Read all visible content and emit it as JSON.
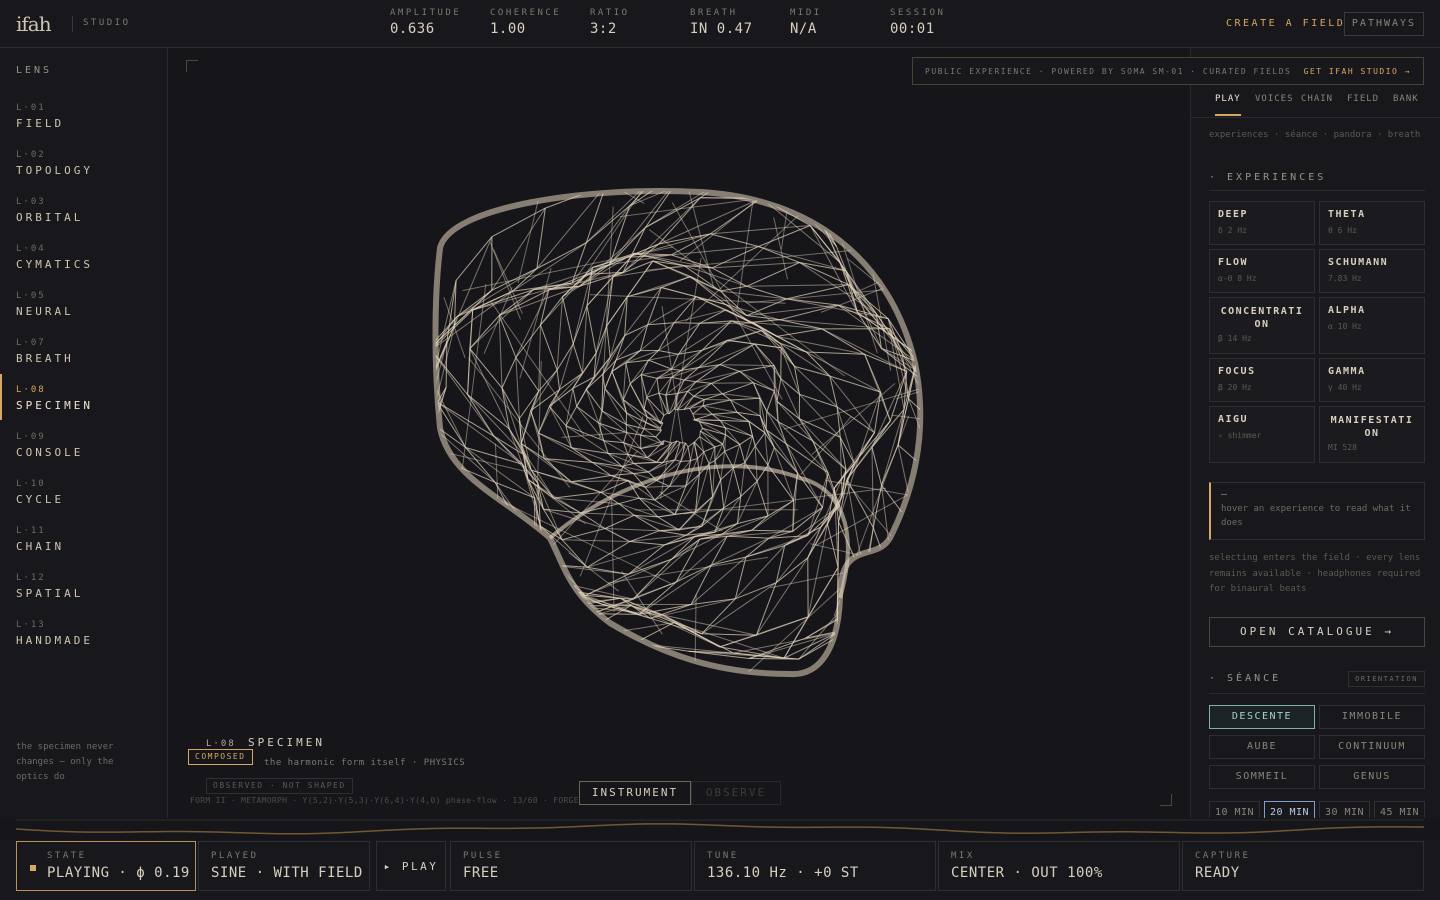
{
  "header": {
    "logo": "ifah",
    "studio": "STUDIO",
    "metrics": [
      {
        "label": "AMPLITUDE",
        "value": "0.636"
      },
      {
        "label": "COHERENCE",
        "value": "1.00"
      },
      {
        "label": "RATIO",
        "value": "3:2"
      },
      {
        "label": "BREATH",
        "value": "IN 0.47"
      },
      {
        "label": "MIDI",
        "value": "N/A"
      },
      {
        "label": "SESSION",
        "value": "00:01"
      }
    ],
    "create_label": "CREATE A FIELD",
    "pathways_label": "PATHWAYS"
  },
  "sidebar": {
    "title": "LENS",
    "items": [
      {
        "code": "L·01",
        "name": "FIELD"
      },
      {
        "code": "L·02",
        "name": "TOPOLOGY"
      },
      {
        "code": "L·03",
        "name": "ORBITAL"
      },
      {
        "code": "L·04",
        "name": "CYMATICS"
      },
      {
        "code": "L·05",
        "name": "NEURAL"
      },
      {
        "code": "L·07",
        "name": "BREATH"
      },
      {
        "code": "L·08",
        "name": "SPECIMEN"
      },
      {
        "code": "L·09",
        "name": "CONSOLE"
      },
      {
        "code": "L·10",
        "name": "CYCLE"
      },
      {
        "code": "L·11",
        "name": "CHAIN"
      },
      {
        "code": "L·12",
        "name": "SPATIAL"
      },
      {
        "code": "L·13",
        "name": "HANDMADE"
      }
    ],
    "active_index": 6,
    "note": "the specimen never changes — only the optics do"
  },
  "canvas": {
    "caption_code": "L·08",
    "caption_name": "SPECIMEN",
    "composed_badge": "COMPOSED",
    "description": "the harmonic form itself · PHYSICS",
    "observed_badge": "OBSERVED · NOT SHAPED",
    "formula": "FORM II · METAMORPH · Y(5,2)·Y(5,3)·Y(6,4)·Y(4,0) phase-flow · 13/60 · FORGED IN BLENDER · press E to alternate",
    "mode_instrument": "INSTRUMENT",
    "mode_observe": "OBSERVE"
  },
  "banner": {
    "text": "PUBLIC EXPERIENCE · POWERED BY SOMA SM-01 · CURATED FIELDS",
    "cta": "GET IFAH STUDIO →"
  },
  "panel": {
    "tabs": [
      "PLAY",
      "VOICES",
      "CHAIN",
      "FIELD",
      "BANK"
    ],
    "active_tab": "PLAY",
    "crumbs": "experiences · séance · pandora · breath",
    "experiences_title": "· EXPERIENCES",
    "experiences": [
      {
        "name": "DEEP",
        "freq": "δ 2 Hz"
      },
      {
        "name": "THETA",
        "freq": "θ 6 Hz"
      },
      {
        "name": "FLOW",
        "freq": "α-θ 8 Hz"
      },
      {
        "name": "SCHUMANN",
        "freq": "7.83 Hz"
      },
      {
        "name": "CONCENTRATION",
        "freq": "β 14 Hz"
      },
      {
        "name": "ALPHA",
        "freq": "α 10 Hz"
      },
      {
        "name": "FOCUS",
        "freq": "β 20 Hz"
      },
      {
        "name": "GAMMA",
        "freq": "γ 40 Hz"
      },
      {
        "name": "AIGU",
        "freq": "✧ shimmer"
      },
      {
        "name": "MANIFESTATION",
        "freq": "MI 528"
      }
    ],
    "hover_dash": "—",
    "hover_text": "hover an experience to read what it does",
    "select_note": "selecting enters the field · every lens remains available · headphones required for binaural beats",
    "catalogue_label": "OPEN CATALOGUE →",
    "seance_title": "· SÉANCE",
    "orientation_label": "ORIENTATION",
    "seance_options": [
      "DESCENTE",
      "IMMOBILE",
      "AUBE",
      "CONTINUUM",
      "SOMMEIL",
      "GENUS"
    ],
    "seance_active": "DESCENTE",
    "durations": [
      "10 MIN",
      "20 MIN",
      "30 MIN",
      "45 MIN"
    ],
    "duration_active": "20 MIN"
  },
  "bottom": {
    "state_label": "STATE",
    "state_value": "PLAYING · ϕ 0.19",
    "played_label": "PLAYED",
    "played_value": "SINE · WITH FIELD",
    "play_label": "▸ PLAY",
    "pulse_label": "PULSE",
    "pulse_value": "FREE",
    "tune_label": "TUNE",
    "tune_value": "136.10 Hz · +0 ST",
    "mix_label": "MIX",
    "mix_value": "CENTER · OUT 100%",
    "capture_label": "CAPTURE",
    "capture_value": "READY"
  },
  "colors": {
    "accent": "#d7a865",
    "mesh": "#e3d6bd",
    "seance_active": "#7fb2a8",
    "duration_active": "#7f9fc8",
    "background": "#16151a"
  }
}
